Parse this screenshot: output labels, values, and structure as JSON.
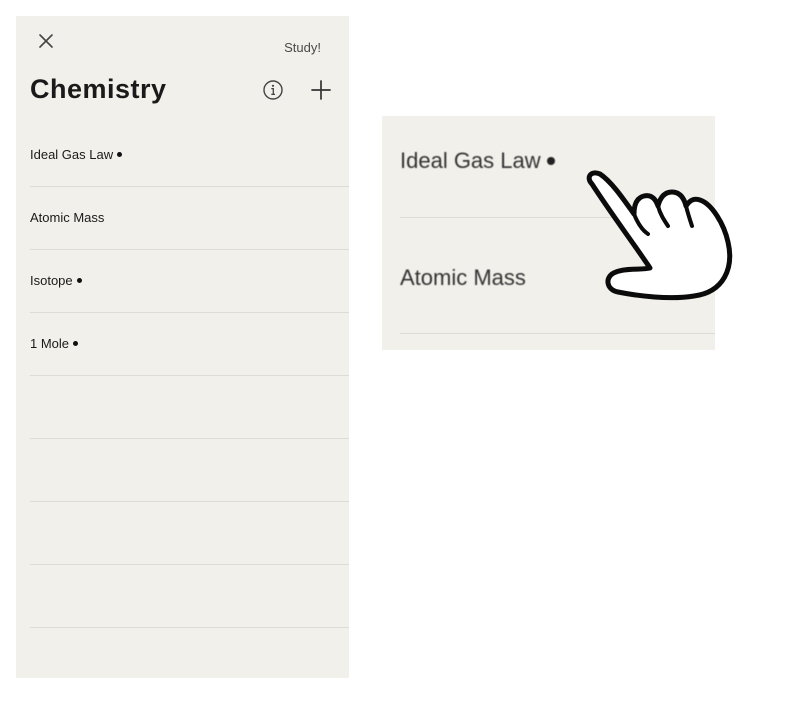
{
  "header": {
    "close_icon": "close-icon",
    "study_label": "Study!",
    "title": "Chemistry",
    "info_icon": "info-icon",
    "add_icon": "plus-icon"
  },
  "cards": [
    {
      "label": "Ideal Gas Law",
      "has_dot": true
    },
    {
      "label": "Atomic Mass",
      "has_dot": false
    },
    {
      "label": "Isotope",
      "has_dot": true
    },
    {
      "label": "1 Mole",
      "has_dot": true
    },
    {
      "label": "",
      "has_dot": false
    },
    {
      "label": "",
      "has_dot": false
    },
    {
      "label": "",
      "has_dot": false
    },
    {
      "label": "",
      "has_dot": false
    },
    {
      "label": "",
      "has_dot": false
    }
  ],
  "zoom": {
    "items": [
      {
        "label": "Ideal Gas Law",
        "has_dot": true
      },
      {
        "label": "Atomic Mass",
        "has_dot": false
      }
    ],
    "pointer_icon": "tap-hand-icon"
  },
  "colors": {
    "panel_bg": "#f2f0eb",
    "divider": "#dedbd4",
    "text": "#1a1a1a"
  }
}
